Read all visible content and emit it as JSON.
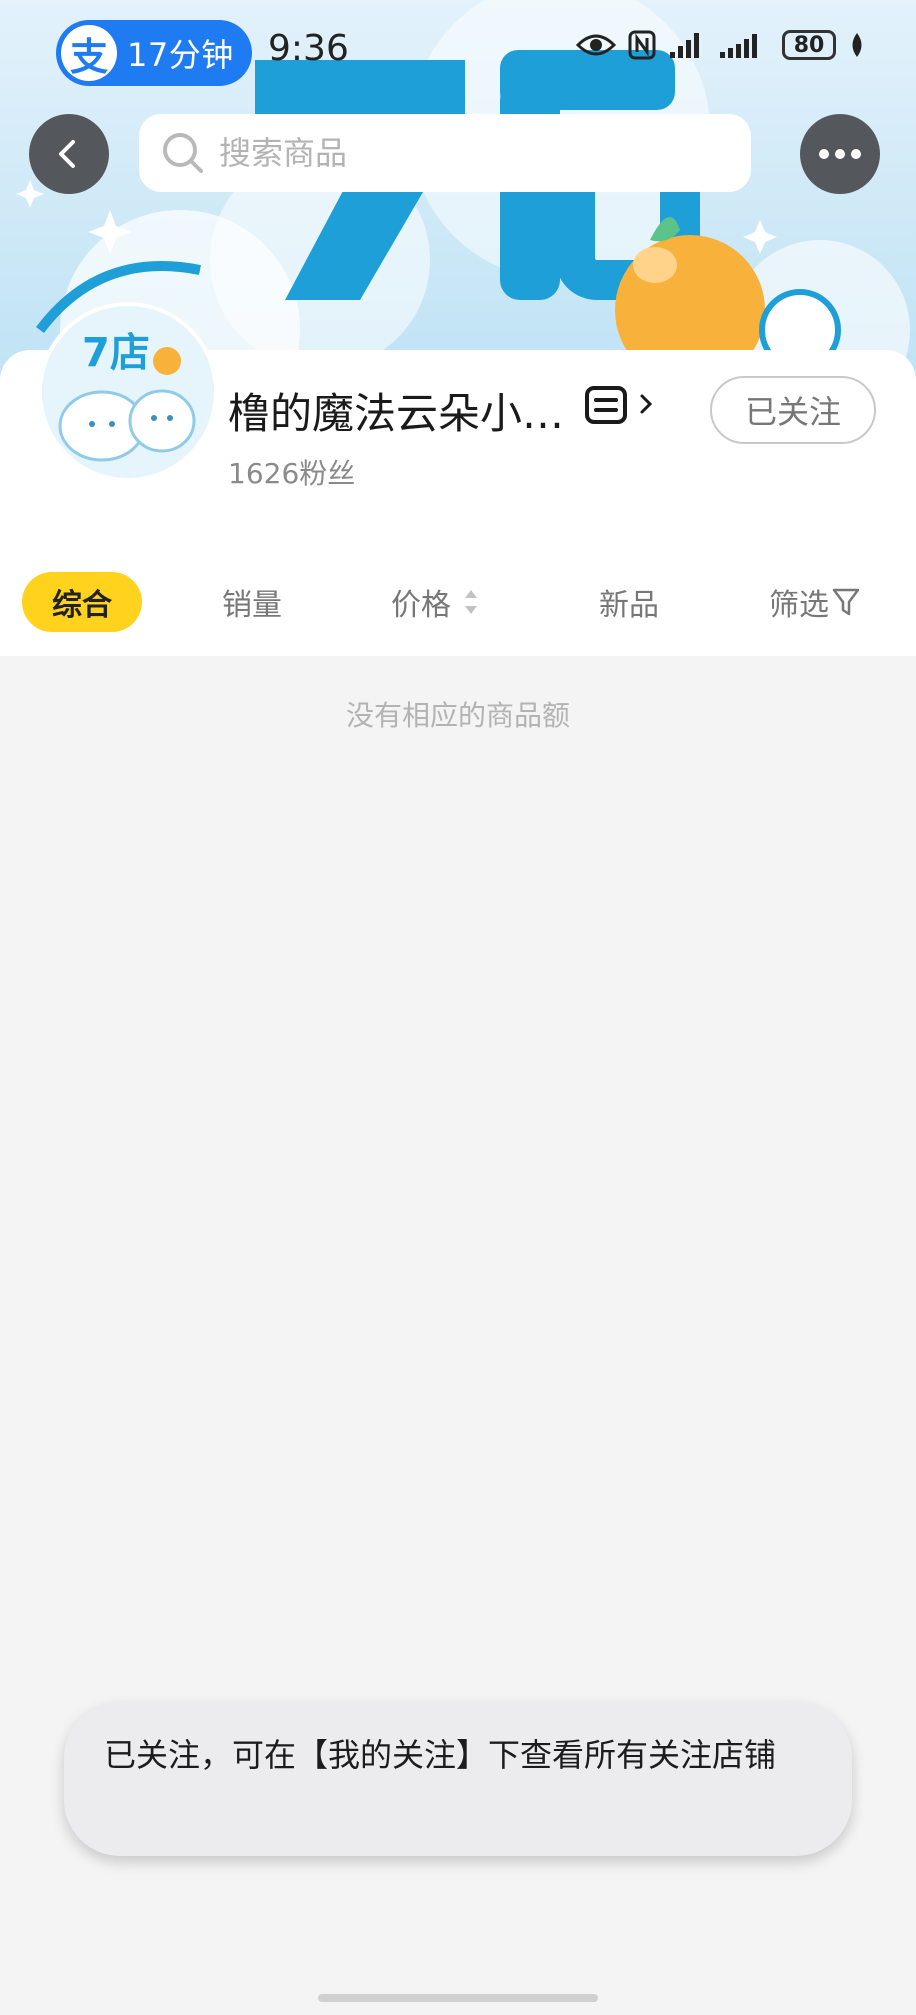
{
  "status_bar": {
    "pill_logo": "支",
    "pill_text": "17分钟",
    "time": "9:36",
    "battery": "80",
    "icons": [
      "eye-icon",
      "nfc-icon",
      "signal-icon",
      "signal-icon",
      "battery-icon",
      "leaf-icon"
    ]
  },
  "nav": {
    "back_icon": "back-arrow-icon",
    "search_placeholder": "搜索商品",
    "more_icon": "more-dots-icon"
  },
  "shop": {
    "name": "橹的魔法云朵小…",
    "fans": "1626粉丝",
    "follow_label": "已关注",
    "avatar_text": "7店"
  },
  "sort_tabs": [
    {
      "label": "综合",
      "active": true
    },
    {
      "label": "销量",
      "active": false
    },
    {
      "label": "价格",
      "active": false
    },
    {
      "label": "新品",
      "active": false
    },
    {
      "label": "筛选",
      "active": false
    }
  ],
  "empty_message": "没有相应的商品额",
  "toast": {
    "message": "已关注，可在【我的关注】下查看所有关注店铺"
  },
  "colors": {
    "brand_blue": "#1f7bf2",
    "active_tab": "#ffd21e",
    "banner_blue": "#1e9fd8"
  }
}
